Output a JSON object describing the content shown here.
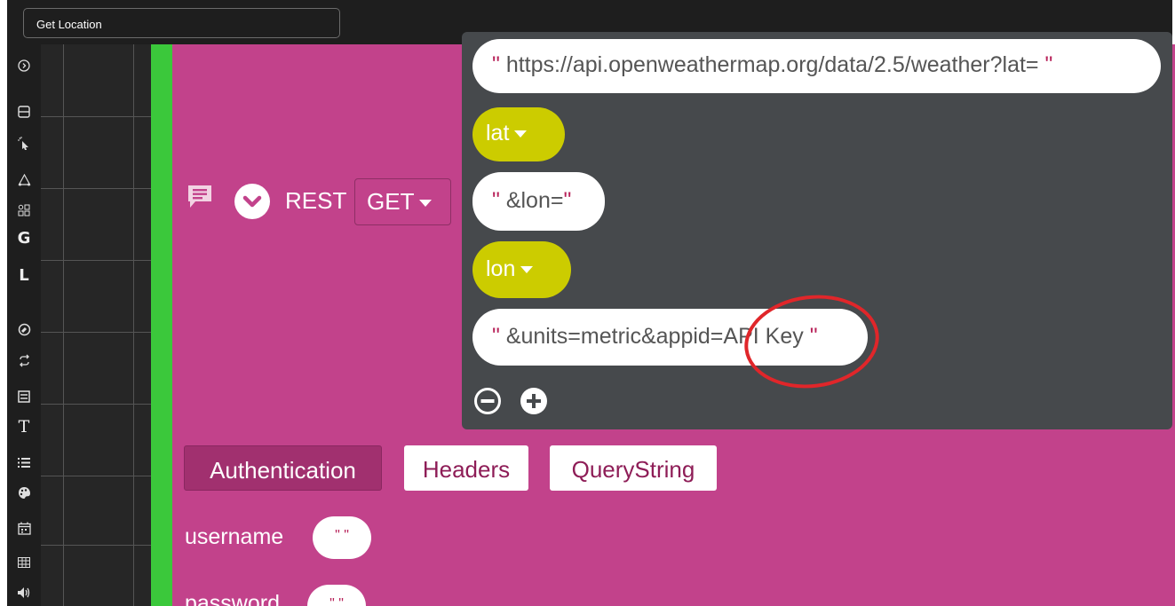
{
  "tab_title": "Get Location",
  "toolbar": {
    "icons": [
      "chevron-right-circle-icon",
      "layout-icon",
      "pointer-icon",
      "shapes-icon",
      "components-icon",
      "g-icon",
      "l-icon",
      "compass-icon",
      "loop-icon",
      "calculator-icon",
      "text-icon",
      "list-icon",
      "palette-icon",
      "calendar-icon",
      "table-icon",
      "speaker-icon"
    ],
    "letters": {
      "g": "G",
      "l": "L",
      "t": "T"
    }
  },
  "block": {
    "label": "REST",
    "method": "GET",
    "url_parts": [
      {
        "type": "text",
        "value": "https://api.openweathermap.org/data/2.5/weather?lat="
      },
      {
        "type": "var",
        "value": "lat"
      },
      {
        "type": "text",
        "value": "&lon="
      },
      {
        "type": "var",
        "value": "lon"
      },
      {
        "type": "text",
        "value": "&units=metric&appid=API Key"
      }
    ],
    "tabs": [
      "Authentication",
      "Headers",
      "QueryString"
    ],
    "fields": [
      {
        "label": "username",
        "value": "\"  \""
      },
      {
        "label": "password",
        "value": "\"  \""
      }
    ]
  },
  "quote_char": "\"",
  "colors": {
    "block": "#c2428b",
    "accent": "#3bc83b",
    "variable": "#cccc00",
    "annotation": "#e0262a"
  }
}
